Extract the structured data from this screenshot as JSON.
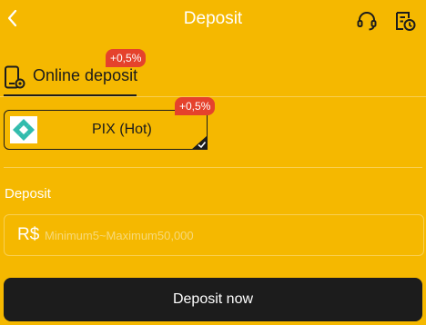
{
  "header": {
    "title": "Deposit",
    "icons": [
      "chevron-left-icon",
      "headset-icon",
      "history-icon"
    ]
  },
  "tabs": [
    {
      "label": "Online deposit",
      "bonus": "+0,5%",
      "icon": "phone-icon",
      "active": true
    }
  ],
  "methods": [
    {
      "label": "PIX (Hot)",
      "bonus": "+0,5%",
      "icon": "pix-icon",
      "selected": true
    }
  ],
  "deposit": {
    "label": "Deposit",
    "currency": "R$",
    "placeholder": "Minimum5~Maximum50,000",
    "value": ""
  },
  "submit": {
    "label": "Deposit now"
  },
  "colors": {
    "background": "#f5b800",
    "dark": "#1c1c1c",
    "badge": "#e5422c",
    "pix": "#32bcad"
  }
}
